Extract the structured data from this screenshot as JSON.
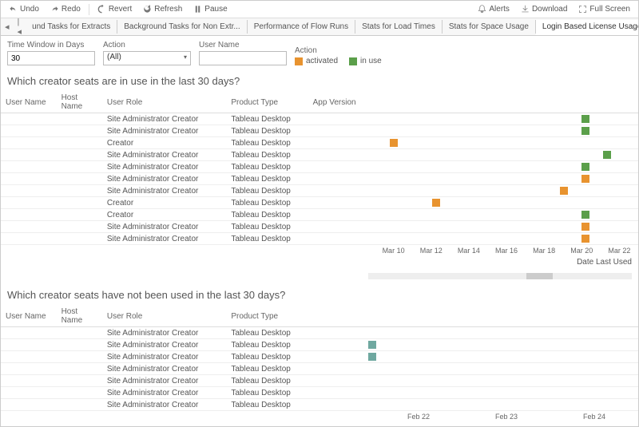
{
  "toolbar": {
    "undo": "Undo",
    "redo": "Redo",
    "revert": "Revert",
    "refresh": "Refresh",
    "pause": "Pause",
    "alerts": "Alerts",
    "download": "Download",
    "fullscreen": "Full Screen"
  },
  "tabs": {
    "items": [
      "und Tasks for Extracts",
      "Background Tasks for Non Extr...",
      "Performance of Flow Runs",
      "Stats for Load Times",
      "Stats for Space Usage",
      "Login Based License Usage"
    ],
    "activeIndex": 5
  },
  "filters": {
    "timeWindow": {
      "label": "Time Window in Days",
      "value": "30"
    },
    "action": {
      "label": "Action",
      "value": "(All)"
    },
    "userName": {
      "label": "User Name",
      "value": ""
    },
    "legendTitle": "Action",
    "legend": [
      {
        "label": "activated",
        "color": "#e8932f"
      },
      {
        "label": "in use",
        "color": "#5b9f4a"
      }
    ]
  },
  "section1": {
    "title": "Which creator seats are in use in the last 30 days?",
    "headers": {
      "un": "User Name",
      "hn": "Host Name",
      "ur": "User Role",
      "pt": "Product Type",
      "av": "App Version"
    },
    "axisLabel": "Date Last Used"
  },
  "section2": {
    "title": "Which creator seats have not been used in the last 30 days?",
    "headers": {
      "un": "User Name",
      "hn": "Host Name",
      "ur": "User Role",
      "pt": "Product Type"
    }
  },
  "chart_data": [
    {
      "type": "scatter",
      "title": "Which creator seats are in use in the last 30 days?",
      "xlabel": "Date Last Used",
      "ylabel": "",
      "x_ticks": [
        "Mar 10",
        "Mar 12",
        "Mar 14",
        "Mar 16",
        "Mar 18",
        "Mar 20",
        "Mar 22"
      ],
      "xlim": [
        "Mar 10",
        "Mar 22"
      ],
      "series": [
        {
          "name": "activated",
          "color": "#e8932f"
        },
        {
          "name": "in use",
          "color": "#5b9f4a"
        }
      ],
      "rows": [
        {
          "user_role": "Site Administrator Creator",
          "product_type": "Tableau Desktop",
          "date": "Mar 20",
          "action": "in use"
        },
        {
          "user_role": "Site Administrator Creator",
          "product_type": "Tableau Desktop",
          "date": "Mar 20",
          "action": "in use"
        },
        {
          "user_role": "Creator",
          "product_type": "Tableau Desktop",
          "date": "Mar 11",
          "action": "activated"
        },
        {
          "user_role": "Site Administrator Creator",
          "product_type": "Tableau Desktop",
          "date": "Mar 21",
          "action": "in use"
        },
        {
          "user_role": "Site Administrator Creator",
          "product_type": "Tableau Desktop",
          "date": "Mar 20",
          "action": "in use"
        },
        {
          "user_role": "Site Administrator Creator",
          "product_type": "Tableau Desktop",
          "date": "Mar 20",
          "action": "activated"
        },
        {
          "user_role": "Site Administrator Creator",
          "product_type": "Tableau Desktop",
          "date": "Mar 19",
          "action": "activated"
        },
        {
          "user_role": "Creator",
          "product_type": "Tableau Desktop",
          "date": "Mar 13",
          "action": "activated"
        },
        {
          "user_role": "Creator",
          "product_type": "Tableau Desktop",
          "date": "Mar 20",
          "action": "in use"
        },
        {
          "user_role": "Site Administrator Creator",
          "product_type": "Tableau Desktop",
          "date": "Mar 20",
          "action": "activated"
        },
        {
          "user_role": "Site Administrator Creator",
          "product_type": "Tableau Desktop",
          "date": "Mar 20",
          "action": "activated"
        }
      ]
    },
    {
      "type": "scatter",
      "title": "Which creator seats have not been used in the last 30 days?",
      "xlabel": "",
      "ylabel": "",
      "x_ticks": [
        "Feb 22",
        "Feb 23",
        "Feb 24"
      ],
      "xlim": [
        "Feb 22",
        "Feb 24"
      ],
      "rows": [
        {
          "user_role": "Site Administrator Creator",
          "product_type": "Tableau Desktop",
          "date": null
        },
        {
          "user_role": "Site Administrator Creator",
          "product_type": "Tableau Desktop",
          "date": "Feb 22"
        },
        {
          "user_role": "Site Administrator Creator",
          "product_type": "Tableau Desktop",
          "date": "Feb 22"
        },
        {
          "user_role": "Site Administrator Creator",
          "product_type": "Tableau Desktop",
          "date": null
        },
        {
          "user_role": "Site Administrator Creator",
          "product_type": "Tableau Desktop",
          "date": null
        },
        {
          "user_role": "Site Administrator Creator",
          "product_type": "Tableau Desktop",
          "date": null
        },
        {
          "user_role": "Site Administrator Creator",
          "product_type": "Tableau Desktop",
          "date": null
        }
      ]
    }
  ]
}
